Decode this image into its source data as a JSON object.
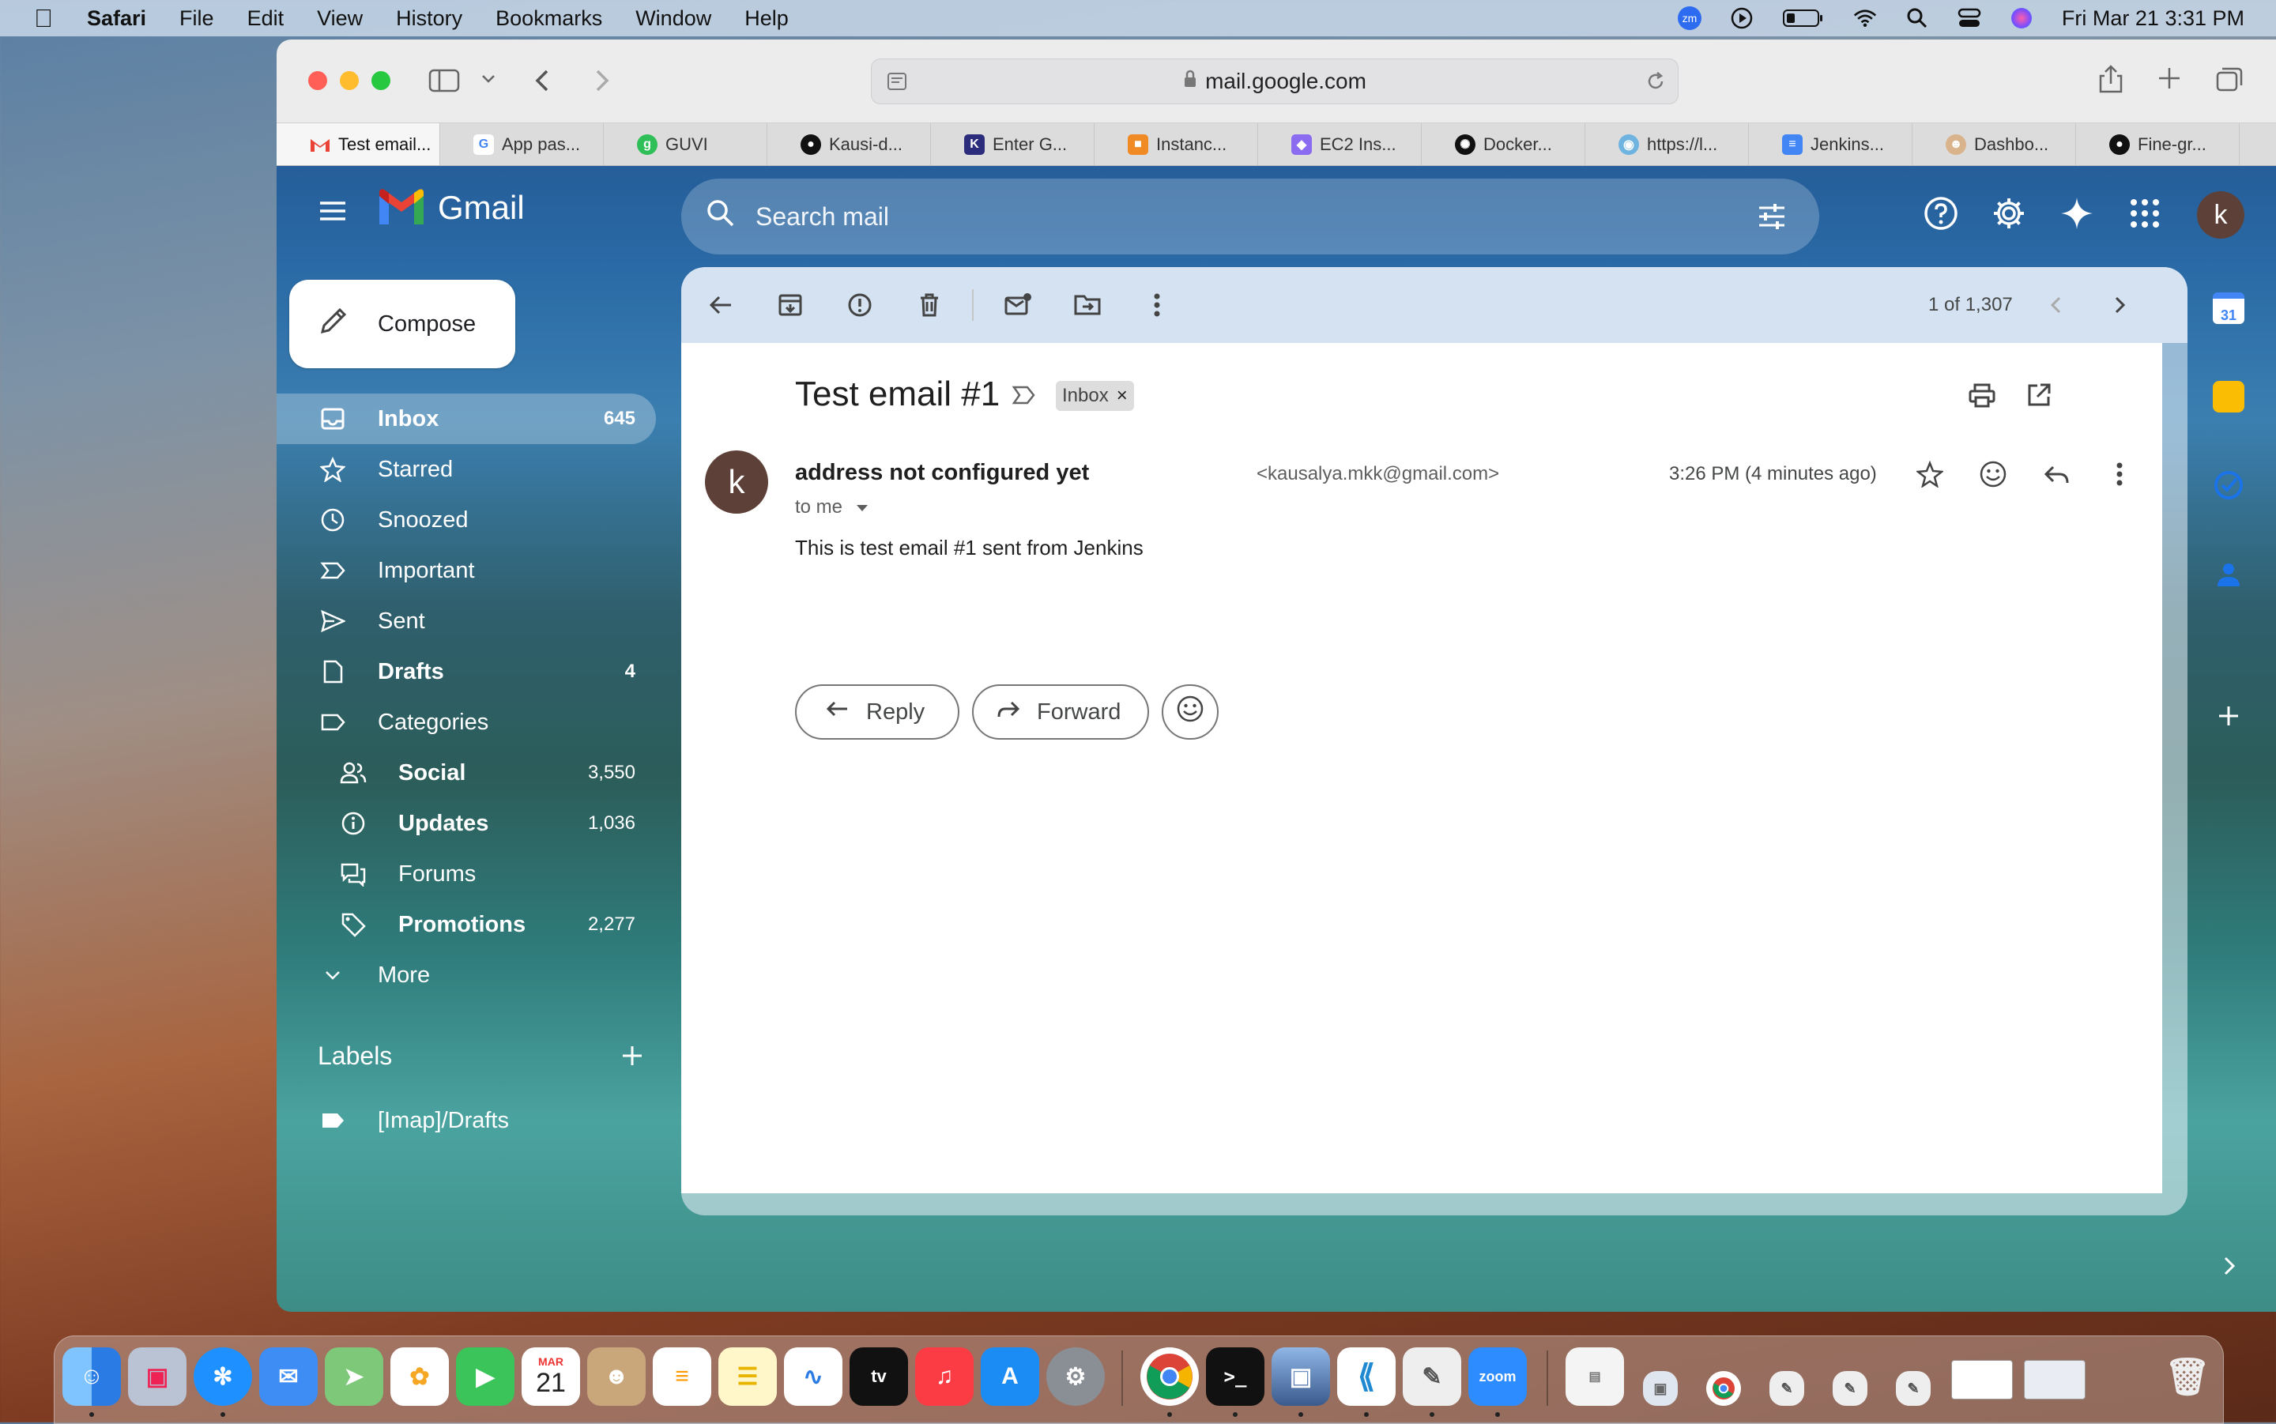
{
  "menubar": {
    "app_name": "Safari",
    "menus": [
      "File",
      "Edit",
      "View",
      "History",
      "Bookmarks",
      "Window",
      "Help"
    ],
    "clock": "Fri Mar 21  3:31 PM",
    "zoom_badge": "zm"
  },
  "browser": {
    "url": "mail.google.com",
    "tabs": [
      {
        "label": "Test email...",
        "icon": "gmail-icon"
      },
      {
        "label": "App pas...",
        "icon": "google-icon"
      },
      {
        "label": "GUVI",
        "icon": "guvi-icon"
      },
      {
        "label": "Kausi-d...",
        "icon": "github-icon"
      },
      {
        "label": "Enter G...",
        "icon": "k-icon"
      },
      {
        "label": "Instanc...",
        "icon": "aws-icon"
      },
      {
        "label": "EC2 Ins...",
        "icon": "ec2-icon"
      },
      {
        "label": "Docker...",
        "icon": "docker-icon"
      },
      {
        "label": "https://l...",
        "icon": "eye-icon"
      },
      {
        "label": "Jenkins...",
        "icon": "docs-icon"
      },
      {
        "label": "Dashbo...",
        "icon": "jenkins-icon"
      },
      {
        "label": "Fine-gr...",
        "icon": "github-icon"
      }
    ]
  },
  "gmail": {
    "logo_text": "Gmail",
    "search_placeholder": "Search mail",
    "avatar_letter": "k",
    "compose_label": "Compose",
    "nav": [
      {
        "label": "Inbox",
        "count": "645",
        "icon": "inbox-icon",
        "active": true
      },
      {
        "label": "Starred",
        "count": "",
        "icon": "star-icon"
      },
      {
        "label": "Snoozed",
        "count": "",
        "icon": "clock-icon"
      },
      {
        "label": "Important",
        "count": "",
        "icon": "important-icon"
      },
      {
        "label": "Sent",
        "count": "",
        "icon": "send-icon"
      },
      {
        "label": "Drafts",
        "count": "4",
        "icon": "draft-icon"
      },
      {
        "label": "Categories",
        "count": "",
        "icon": "label-icon"
      }
    ],
    "categories": [
      {
        "label": "Social",
        "count": "3,550",
        "icon": "people-icon"
      },
      {
        "label": "Updates",
        "count": "1,036",
        "icon": "info-icon"
      },
      {
        "label": "Forums",
        "count": "",
        "icon": "forum-icon"
      },
      {
        "label": "Promotions",
        "count": "2,277",
        "icon": "tag-icon"
      }
    ],
    "more_label": "More",
    "labels_heading": "Labels",
    "labels": [
      "[Imap]/Drafts"
    ],
    "pagination": "1 of 1,307",
    "email": {
      "subject": "Test email #1",
      "label_chip": "Inbox",
      "sender_name": "address not configured yet",
      "sender_email": "<kausalya.mkk@gmail.com>",
      "time": "3:26 PM (4 minutes ago)",
      "to": "to me",
      "body": "This is test email #1 sent from Jenkins",
      "avatar_letter": "k"
    },
    "reply_label": "Reply",
    "forward_label": "Forward"
  },
  "side_panel": {
    "calendar_day": "31"
  },
  "dock": {
    "calendar_month": "MAR",
    "calendar_day": "21",
    "zoom_label": "zoom",
    "tv_label": "tv"
  },
  "colors": {
    "gmail_red": "#ea4335",
    "avatar_brown": "#5d4037",
    "accent_blue": "#0b57d0"
  }
}
